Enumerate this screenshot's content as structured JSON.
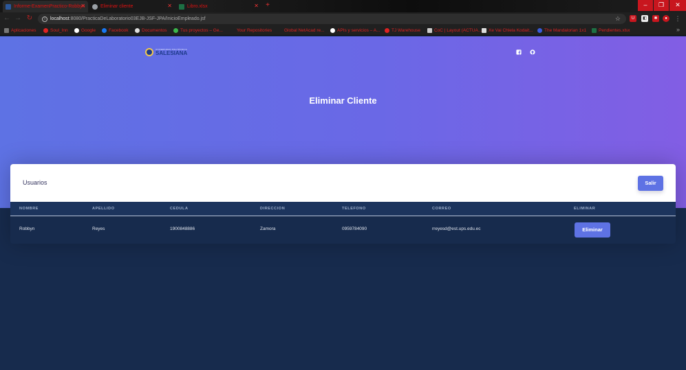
{
  "browser": {
    "tabs": [
      {
        "title": "Informe-ExamenPractico-Robbyn",
        "icon": "word-doc-icon",
        "color": "#2b579a"
      },
      {
        "title": "Eliminar cliente",
        "icon": "globe-icon",
        "color": "#9aa0a6"
      },
      {
        "title": "Libro.xlsx",
        "icon": "excel-icon",
        "color": "#1d7044"
      }
    ],
    "url_host": "localhost",
    "url_path": ":8080/PracticaDeLaboratorio03EJB-JSF-JPA/InicioEmpleado.jsf",
    "bookmarks": [
      "Aplicaciones",
      "Soul_Inn",
      "Google",
      "Facebook",
      "Documentos",
      "Tus proyectos – Ge...",
      "Your Repositories",
      "Global NetAcad re...",
      "APIs y servicios – A...",
      "TJ Warehouse",
      "CoC | Layout (ACTUA...",
      "Xe Vai Chlela Kodait...",
      "The Mandalorian 1x1",
      "Pendientes.xlsx"
    ]
  },
  "brand": {
    "logo_small": "UNIVERSIDAD POLITÉCNICA",
    "logo_text": "SALESIANA"
  },
  "social": [
    "facebook-icon",
    "github-icon"
  ],
  "hero": {
    "title": "Eliminar Cliente"
  },
  "card": {
    "title": "Usuarios",
    "exit_label": "Salir",
    "columns": [
      "NOMBRE",
      "APELLIDO",
      "CEDULA",
      "DIRECCION",
      "TELEFONO",
      "CORREO",
      "ELIMINAR"
    ],
    "rows": [
      {
        "nombre": "Robbyn",
        "apellido": "Reyes",
        "cedula": "1900848886",
        "direccion": "Zamora",
        "telefono": "0959784090",
        "correo": "rreyesd@est.ups.edu.ec",
        "action": "Eliminar"
      }
    ]
  },
  "colors": {
    "primary": "#5e72e4",
    "dark": "#172b4d"
  }
}
